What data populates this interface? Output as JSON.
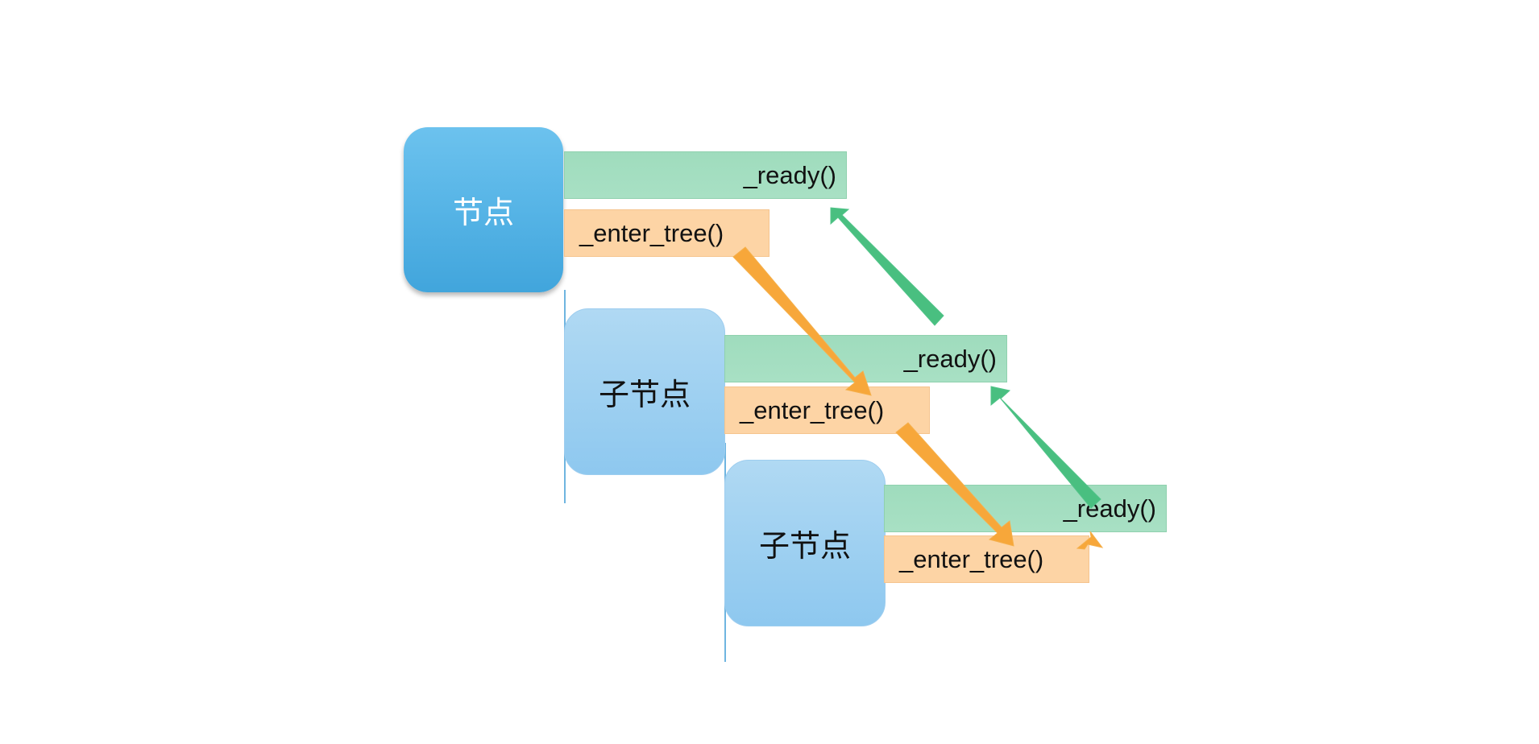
{
  "nodes": {
    "root_label": "节点",
    "child1_label": "子节点",
    "child2_label": "子节点"
  },
  "callbacks": {
    "ready_1": "_ready()",
    "enter_tree_1": "_enter_tree()",
    "ready_2": "_ready()",
    "enter_tree_2": "_enter_tree()",
    "ready_3": "_ready()",
    "enter_tree_3": "_enter_tree()"
  },
  "colors": {
    "root_node": "#56b4e6",
    "child_node": "#9dcdef",
    "ready_bar": "#a8e0c4",
    "enter_tree_bar": "#fdd4a5",
    "down_arrow": "#f7a73a",
    "up_arrow": "#49bf80"
  }
}
